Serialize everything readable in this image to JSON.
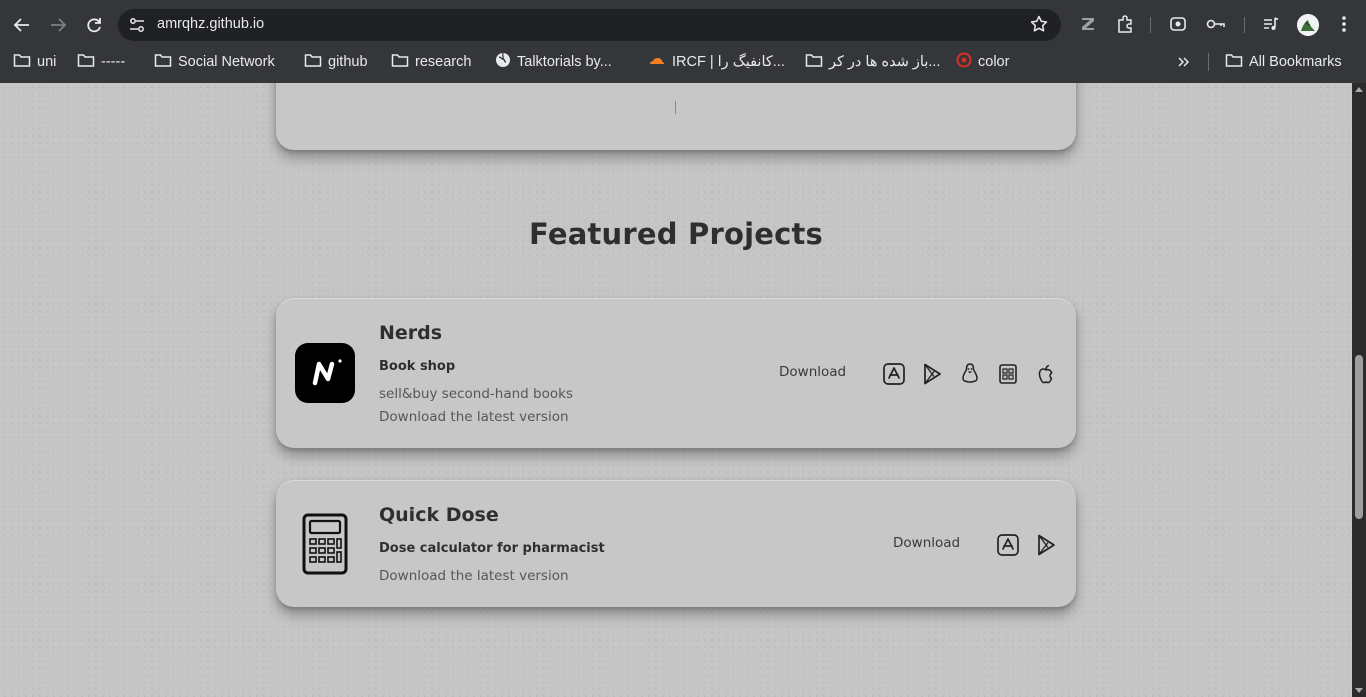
{
  "browser": {
    "url": "amrqhz.github.io",
    "bookmarks": [
      {
        "label": "uni",
        "icon": "folder-icon"
      },
      {
        "label": "-----",
        "icon": "folder-icon"
      },
      {
        "label": "Social Network",
        "icon": "folder-icon"
      },
      {
        "label": "github",
        "icon": "folder-icon"
      },
      {
        "label": "research",
        "icon": "folder-icon"
      },
      {
        "label": "Talktorials by...",
        "icon": "globe-icon"
      },
      {
        "label": "IRCF | کانفیگ را...",
        "icon": "cloudflare-icon"
      },
      {
        "label": "باز شده ها در کر...",
        "icon": "folder-icon"
      },
      {
        "label": "color",
        "icon": "color-icon"
      }
    ],
    "all_bookmarks": "All Bookmarks",
    "toolbar_icons": [
      "back-icon",
      "forward-icon",
      "reload-icon",
      "site-info-icon",
      "star-icon",
      "zotero-icon",
      "extensions-icon",
      "screen-capture-icon",
      "password-key-icon",
      "media-control-icon",
      "profile-avatar",
      "menu-icon"
    ]
  },
  "page": {
    "section_title": "Featured Projects",
    "projects": [
      {
        "name": "Nerds",
        "subtitle": "Book shop",
        "description": "sell&buy second-hand books",
        "latest": "Download the latest version",
        "download_label": "Download",
        "platforms": [
          "app-store-icon",
          "google-play-icon",
          "linux-icon",
          "windows-icon",
          "apple-icon"
        ]
      },
      {
        "name": "Quick Dose",
        "subtitle": "Dose calculator for pharmacist",
        "latest": "Download the latest version",
        "download_label": "Download",
        "platforms": [
          "app-store-icon",
          "google-play-icon"
        ]
      }
    ]
  },
  "colors": {
    "chrome_bg": "#35363a",
    "omnibox_bg": "#202124",
    "page_bg": "#c5c5c5",
    "card_bg": "#c7c7c7",
    "text_dark": "#2f2f2f"
  }
}
